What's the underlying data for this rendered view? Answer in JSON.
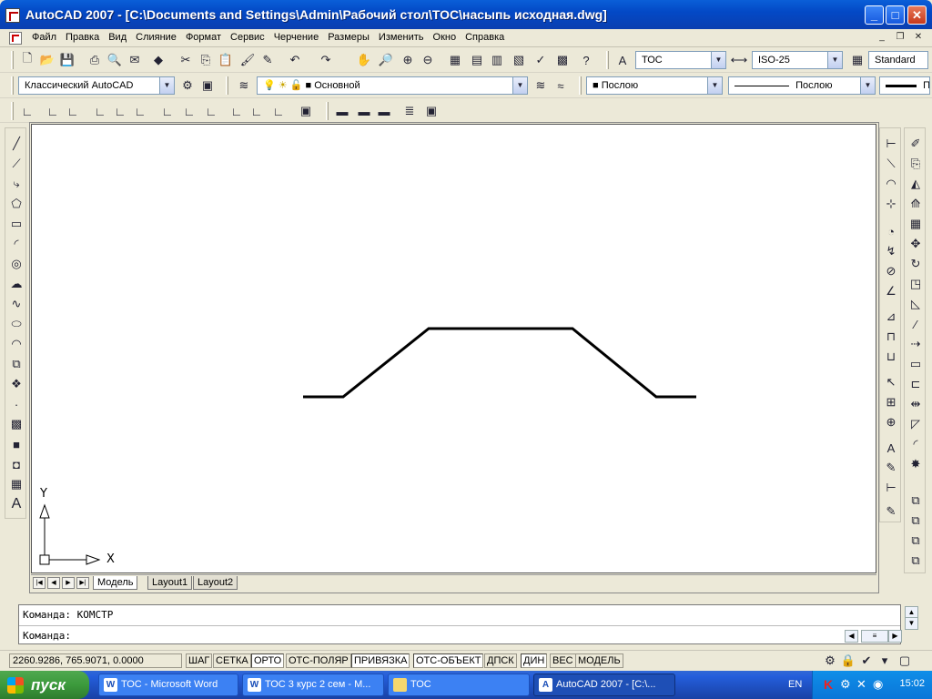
{
  "window": {
    "title": "AutoCAD 2007 - [C:\\Documents and Settings\\Admin\\Рабочий стол\\ТОС\\насыпь исходная.dwg]",
    "min": "_",
    "max": "□",
    "close": "✕"
  },
  "menu": [
    "Файл",
    "Правка",
    "Вид",
    "Слияние",
    "Формат",
    "Сервис",
    "Черчение",
    "Размеры",
    "Изменить",
    "Окно",
    "Справка"
  ],
  "toolbar_standard": {
    "text_style": "ТОС",
    "dim_style": "ISO-25",
    "table_style": "Standard"
  },
  "toolbar_layers": {
    "workspace": "Классический AutoCAD",
    "layer": "Основной",
    "color": "Послою",
    "linetype": "Послою",
    "lineweight": "П"
  },
  "drawing": {
    "ucs_x_label": "X",
    "ucs_y_label": "Y"
  },
  "layout_tabs": [
    "Модель",
    "Layout1",
    "Layout2"
  ],
  "command": {
    "history_line": "Команда: КОМСТР",
    "prompt": "Команда:"
  },
  "status": {
    "coordinates": "2260.9286, 765.9071, 0.0000",
    "toggles": [
      "ШАГ",
      "СЕТКА",
      "ОРТО",
      "ОТС-ПОЛЯР",
      "ПРИВЯЗКА",
      "ОТС-ОБЪЕКТ",
      "ДПСК",
      "ДИН",
      "ВЕС",
      "МОДЕЛЬ"
    ]
  },
  "taskbar": {
    "start_label": "пуск",
    "tasks": [
      "ТОС - Microsoft Word",
      "ТОС 3 курс 2 сем - М...",
      "ТОС",
      "AutoCAD 2007 - [C:\\..."
    ],
    "language": "EN",
    "clock": "15:02"
  }
}
